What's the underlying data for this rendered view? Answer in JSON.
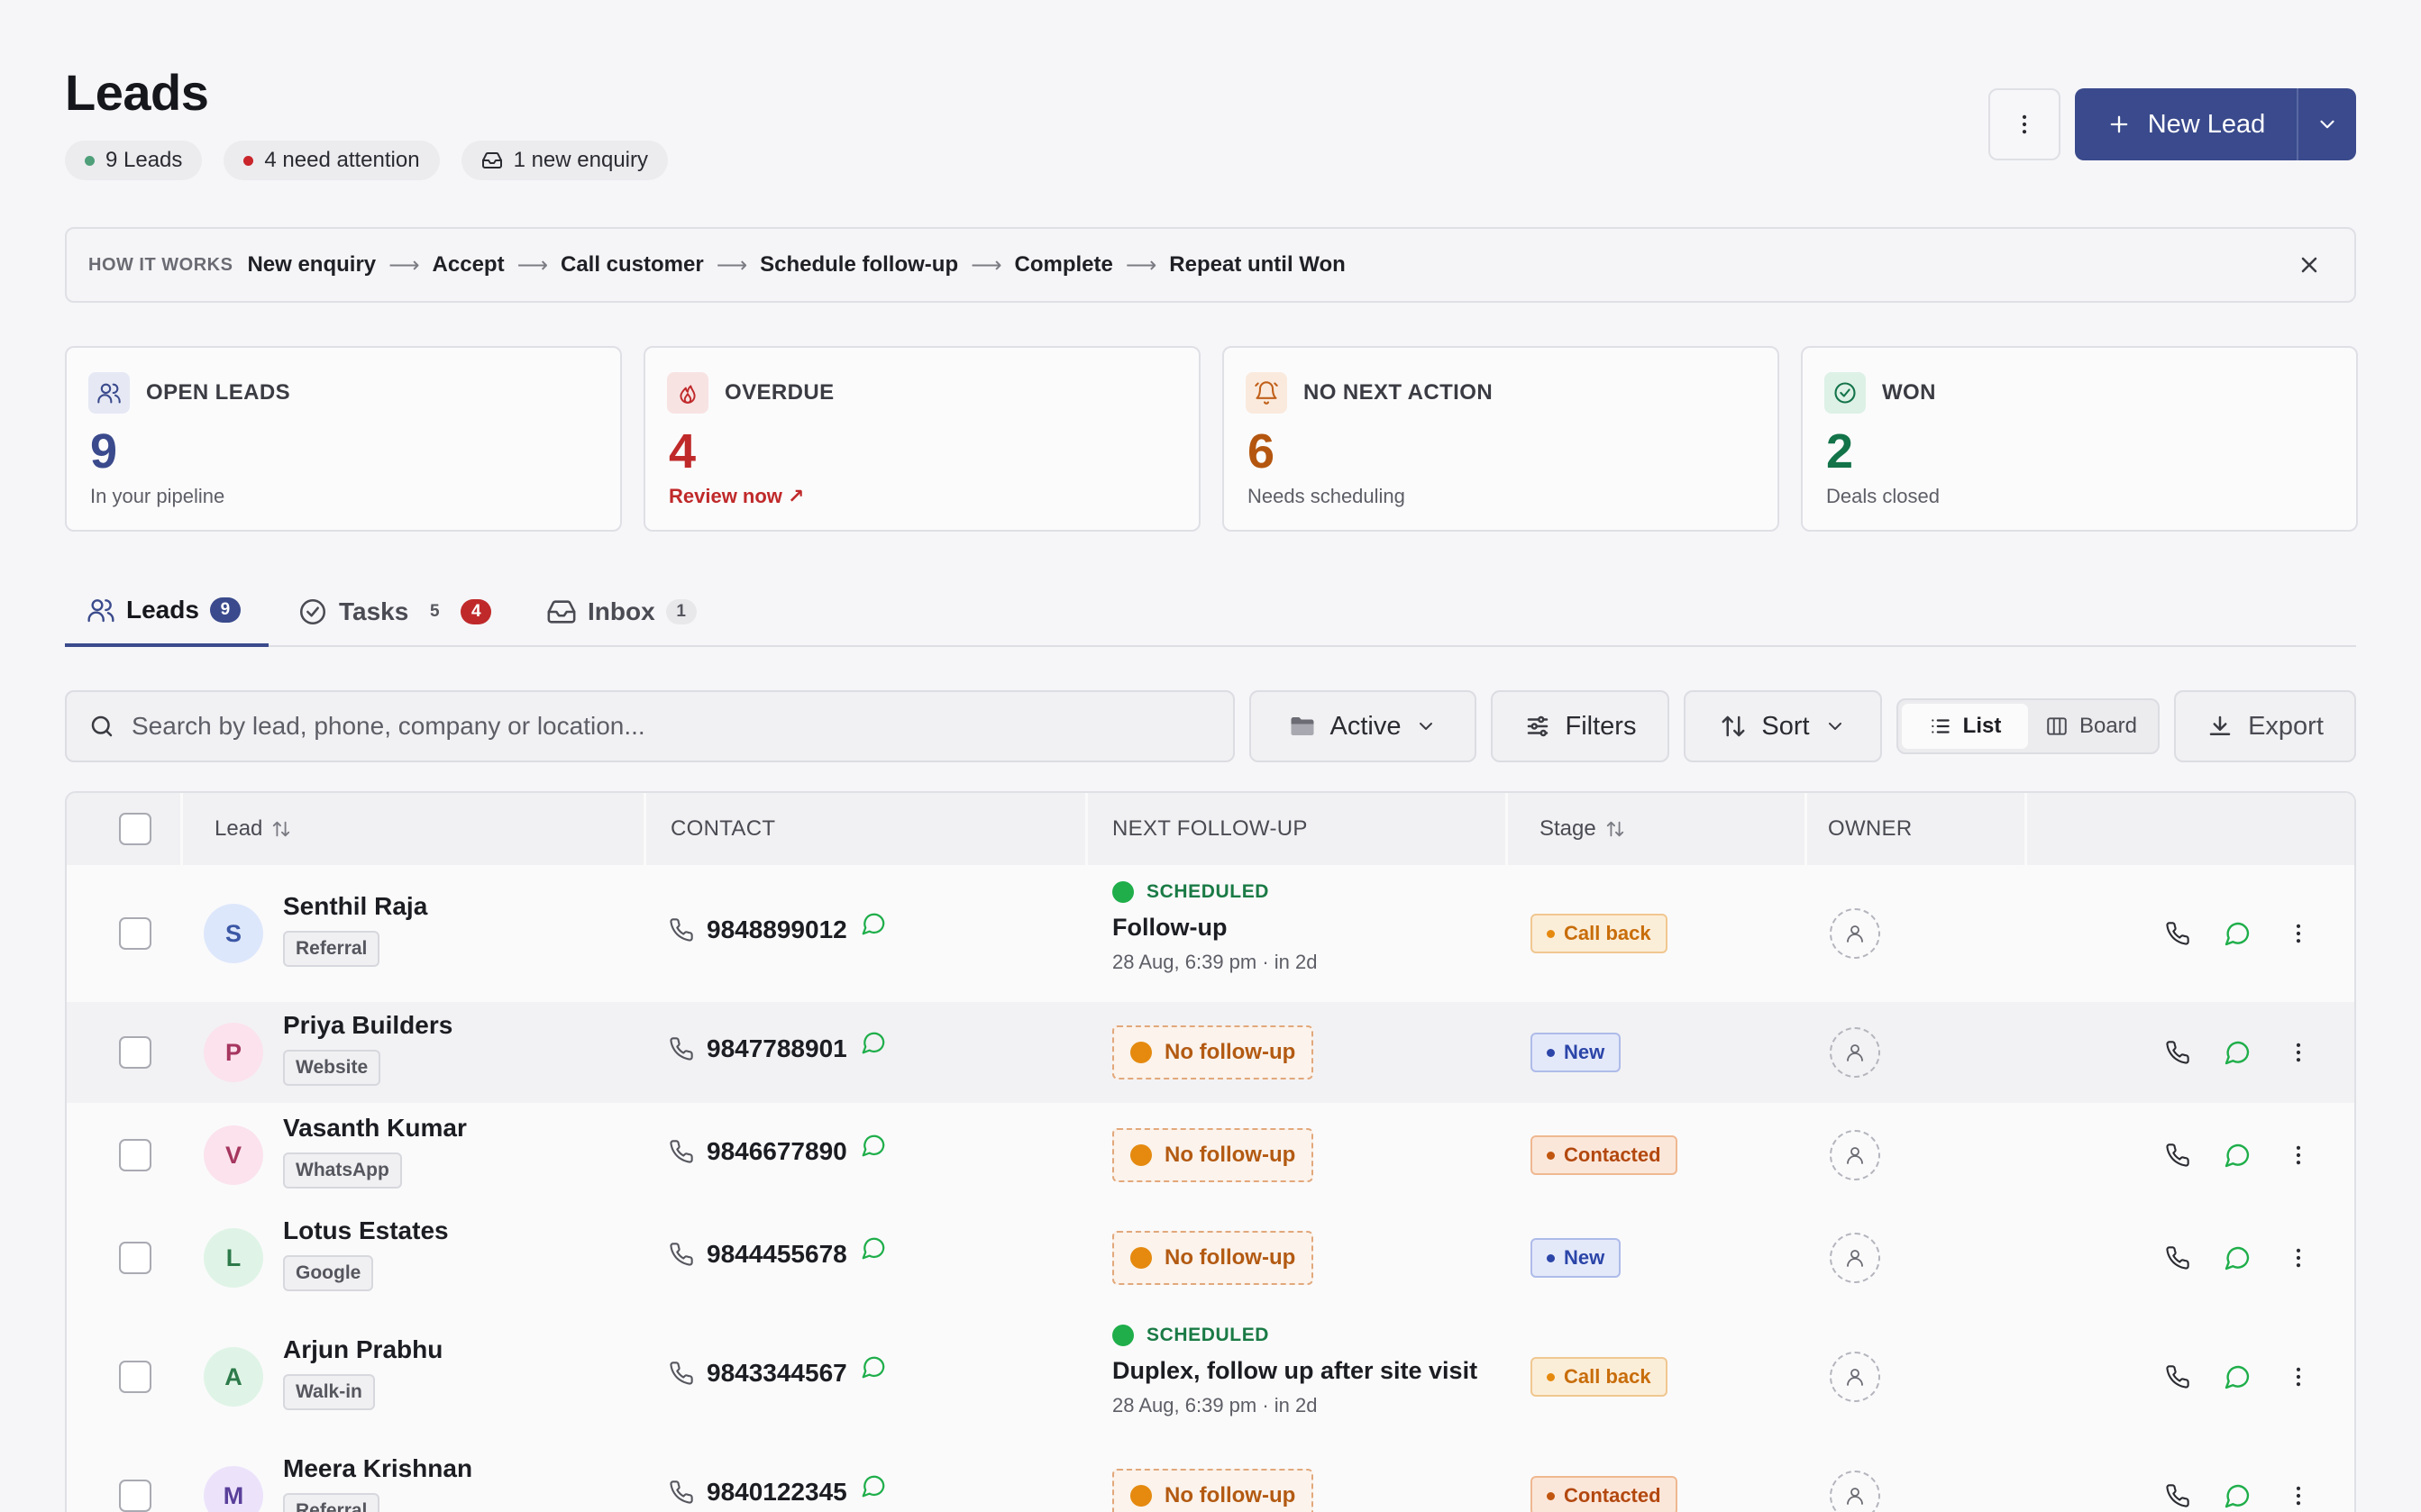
{
  "header": {
    "title": "Leads",
    "chips": [
      {
        "label": "9 Leads",
        "dot_color": "#4f9f7a"
      },
      {
        "label": "4 need attention",
        "dot_color": "#c9252b"
      },
      {
        "label": "1 new enquiry",
        "icon": "inbox-icon"
      }
    ],
    "new_lead_label": "New Lead"
  },
  "how_it_works": {
    "label": "HOW IT WORKS",
    "steps": [
      "New enquiry",
      "Accept",
      "Call customer",
      "Schedule follow-up",
      "Complete",
      "Repeat until Won"
    ]
  },
  "stats": [
    {
      "title": "OPEN LEADS",
      "value": "9",
      "sub": "In your pipeline",
      "color": "#3a4a8c",
      "icon": "users-icon"
    },
    {
      "title": "OVERDUE",
      "value": "4",
      "sub": "Review now",
      "color": "#c0292a",
      "icon": "flame-icon"
    },
    {
      "title": "NO NEXT ACTION",
      "value": "6",
      "sub": "Needs scheduling",
      "color": "#b4560f",
      "icon": "bell-icon"
    },
    {
      "title": "WON",
      "value": "2",
      "sub": "Deals closed",
      "color": "#137349",
      "icon": "check-circle-icon"
    }
  ],
  "tabs": [
    {
      "label": "Leads",
      "count": "9"
    },
    {
      "label": "Tasks",
      "count": "5",
      "alert": "4"
    },
    {
      "label": "Inbox",
      "count": "1"
    }
  ],
  "toolbar": {
    "search_placeholder": "Search by lead, phone, company or location...",
    "status_filter": "Active",
    "filters_label": "Filters",
    "sort_label": "Sort",
    "view_list": "List",
    "view_board": "Board",
    "export_label": "Export"
  },
  "table": {
    "columns": [
      "Lead",
      "CONTACT",
      "NEXT FOLLOW-UP",
      "Stage",
      "OWNER"
    ],
    "rows": [
      {
        "initial": "S",
        "name": "Senthil Raja",
        "source": "Referral",
        "phone": "9848899012",
        "followup": {
          "status": "SCHEDULED",
          "title": "Follow-up",
          "date": "28 Aug, 6:39 pm · in 2d"
        },
        "stage": "Call back",
        "avatar_bg": "#dde7fb",
        "avatar_fg": "#3b57a5"
      },
      {
        "initial": "P",
        "name": "Priya Builders",
        "source": "Website",
        "phone": "9847788901",
        "followup": {
          "status": "No follow-up"
        },
        "stage": "New",
        "avatar_bg": "#fbe2ec",
        "avatar_fg": "#a6365f"
      },
      {
        "initial": "V",
        "name": "Vasanth Kumar",
        "source": "WhatsApp",
        "phone": "9846677890",
        "followup": {
          "status": "No follow-up"
        },
        "stage": "Contacted",
        "avatar_bg": "#fbe2ec",
        "avatar_fg": "#a6365f"
      },
      {
        "initial": "L",
        "name": "Lotus Estates",
        "source": "Google",
        "phone": "9844455678",
        "followup": {
          "status": "No follow-up"
        },
        "stage": "New",
        "avatar_bg": "#dff4e6",
        "avatar_fg": "#2d7a4a"
      },
      {
        "initial": "A",
        "name": "Arjun Prabhu",
        "source": "Walk-in",
        "phone": "9843344567",
        "followup": {
          "status": "SCHEDULED",
          "title": "Duplex, follow up after site visit",
          "date": "28 Aug, 6:39 pm · in 2d"
        },
        "stage": "Call back",
        "avatar_bg": "#dff4e6",
        "avatar_fg": "#2d7a4a"
      },
      {
        "initial": "M",
        "name": "Meera Krishnan",
        "source": "Referral",
        "phone": "9840122345",
        "followup": {
          "status": "No follow-up"
        },
        "stage": "Contacted",
        "avatar_bg": "#ece3fb",
        "avatar_fg": "#5a3f9a"
      }
    ]
  },
  "colors": {
    "primary": "#3a4a8c",
    "stage_call_back": "#c86d0a",
    "stage_new": "#2b45a8",
    "stage_contacted": "#b3480f",
    "whatsapp": "#1fae4a"
  }
}
